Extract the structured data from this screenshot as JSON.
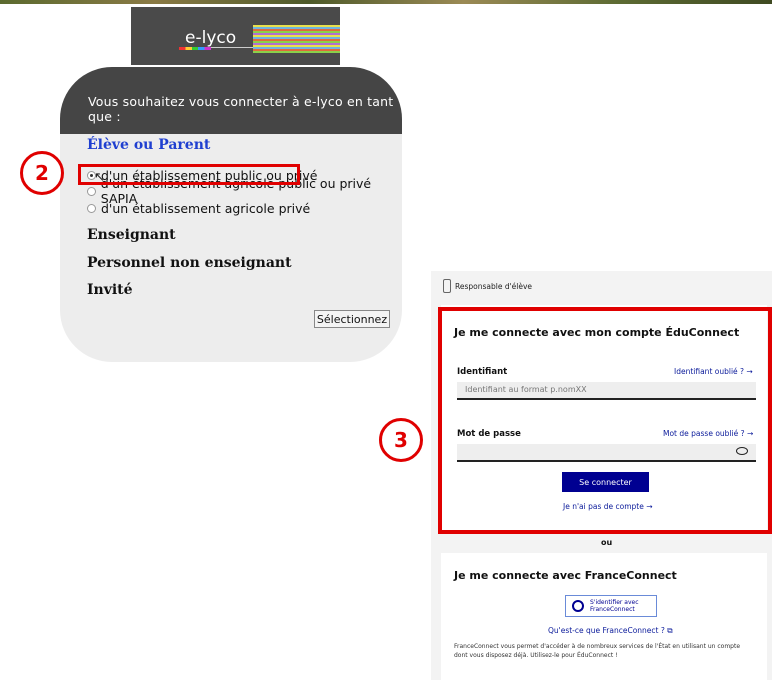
{
  "elyco": {
    "logo_text": "e-lyco",
    "header": "Vous souhaitez vous connecter à e-lyco en tant que :",
    "category_student": "Élève ou Parent",
    "options": [
      {
        "label": "d'un établissement public ou privé",
        "selected": true
      },
      {
        "label": "d'un établissement agricole public ou privé SAPIA",
        "selected": false
      },
      {
        "label": "d'un établissement agricole privé",
        "selected": false
      }
    ],
    "category_teacher": "Enseignant",
    "category_staff": "Personnel non enseignant",
    "category_guest": "Invité",
    "select_button": "Sélectionnez"
  },
  "steps": {
    "step2": "2",
    "step3": "3"
  },
  "educonnect": {
    "role": "Responsable d'élève",
    "title": "Je me connecte avec mon compte ÉduConnect",
    "identifier_label": "Identifiant",
    "identifier_forgot": "Identifiant oublié ? →",
    "identifier_placeholder": "Identifiant au format p.nomXX",
    "password_label": "Mot de passe",
    "password_forgot": "Mot de passe oublié ? →",
    "password_value": "",
    "connect_button": "Se connecter",
    "no_account": "Je n'ai pas de compte →",
    "or": "ou",
    "fc_title": "Je me connecte avec FranceConnect",
    "fc_button_line1": "S'identifier avec",
    "fc_button_line2": "FranceConnect",
    "fc_what": "Qu'est-ce que FranceConnect ? ⧉",
    "fc_desc": "FranceConnect vous permet d'accéder à de nombreux services de l'État en utilisant un compte dont vous disposez déjà. Utilisez-le pour ÉduConnect !"
  },
  "colors": {
    "highlight": "#e00000",
    "link": "#0a1a9a",
    "primary": "#000091",
    "elyco_header": "#454545",
    "elyco_category": "#1f3fd0"
  }
}
